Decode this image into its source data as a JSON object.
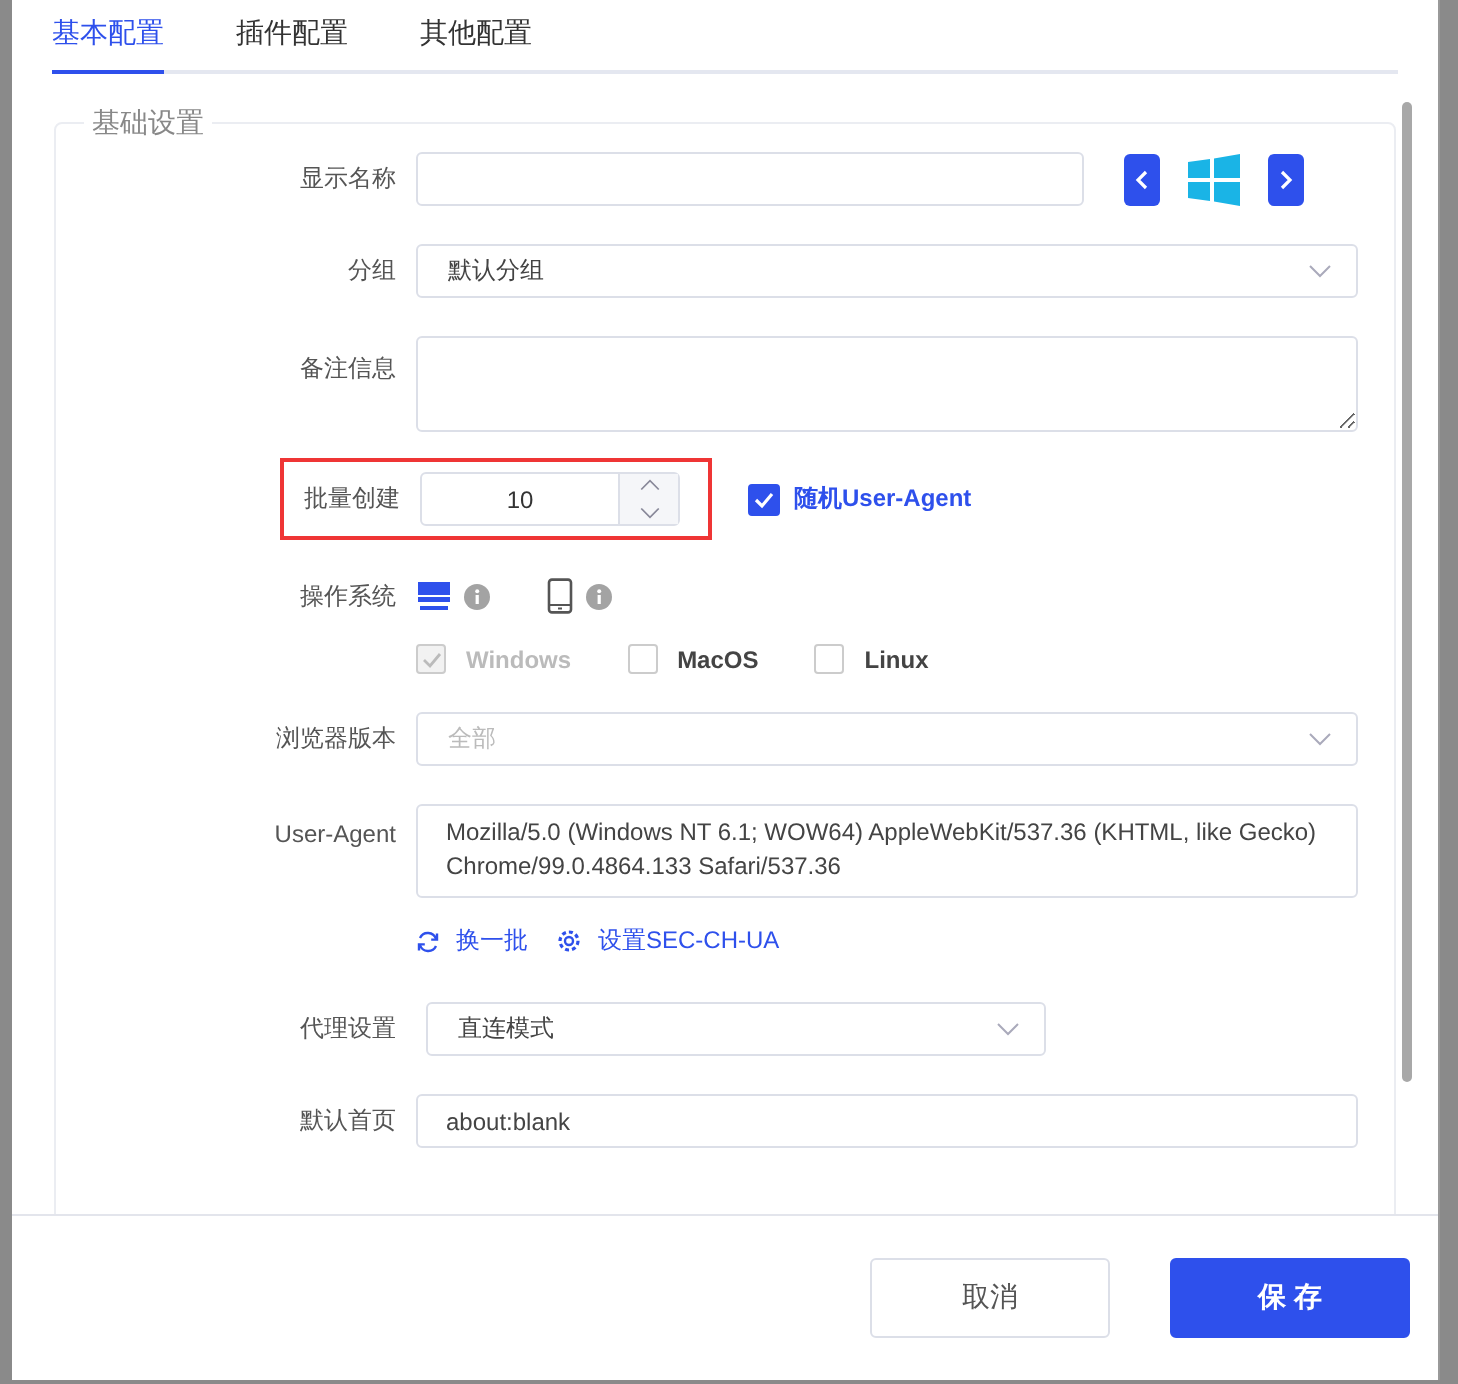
{
  "tabs": [
    {
      "label": "基本配置",
      "selected": true
    },
    {
      "label": "插件配置",
      "selected": false
    },
    {
      "label": "其他配置",
      "selected": false
    }
  ],
  "section": {
    "title": "基础设置"
  },
  "display_name": {
    "label": "显示名称"
  },
  "group": {
    "label": "分组",
    "value": "默认分组"
  },
  "notes": {
    "label": "备注信息"
  },
  "batch": {
    "label": "批量创建",
    "value": "10",
    "highlighted": true,
    "random_ua": {
      "label": "随机User-Agent",
      "checked": true
    }
  },
  "os": {
    "label": "操作系统",
    "devices": [
      {
        "kind": "desktop",
        "selected": true
      },
      {
        "kind": "mobile",
        "selected": false
      }
    ],
    "options": [
      {
        "label": "Windows",
        "checked": true,
        "disabled": true
      },
      {
        "label": "MacOS",
        "checked": false,
        "disabled": false
      },
      {
        "label": "Linux",
        "checked": false,
        "disabled": false
      }
    ]
  },
  "browser_version": {
    "label": "浏览器版本",
    "value": "全部",
    "disabled": true
  },
  "user_agent": {
    "label": "User-Agent",
    "value": "Mozilla/5.0 (Windows NT 6.1; WOW64) AppleWebKit/537.36 (KHTML, like Gecko) Chrome/99.0.4864.133 Safari/537.36",
    "links": [
      {
        "kind": "refresh",
        "label": "换一批"
      },
      {
        "kind": "settings",
        "label": "设置SEC-CH-UA"
      }
    ]
  },
  "proxy": {
    "label": "代理设置",
    "value": "直连模式"
  },
  "homepage": {
    "label": "默认首页",
    "value": "about:blank"
  },
  "buttons": [
    {
      "label": "取消",
      "kind": "secondary"
    },
    {
      "label": "保 存",
      "kind": "primary"
    }
  ]
}
